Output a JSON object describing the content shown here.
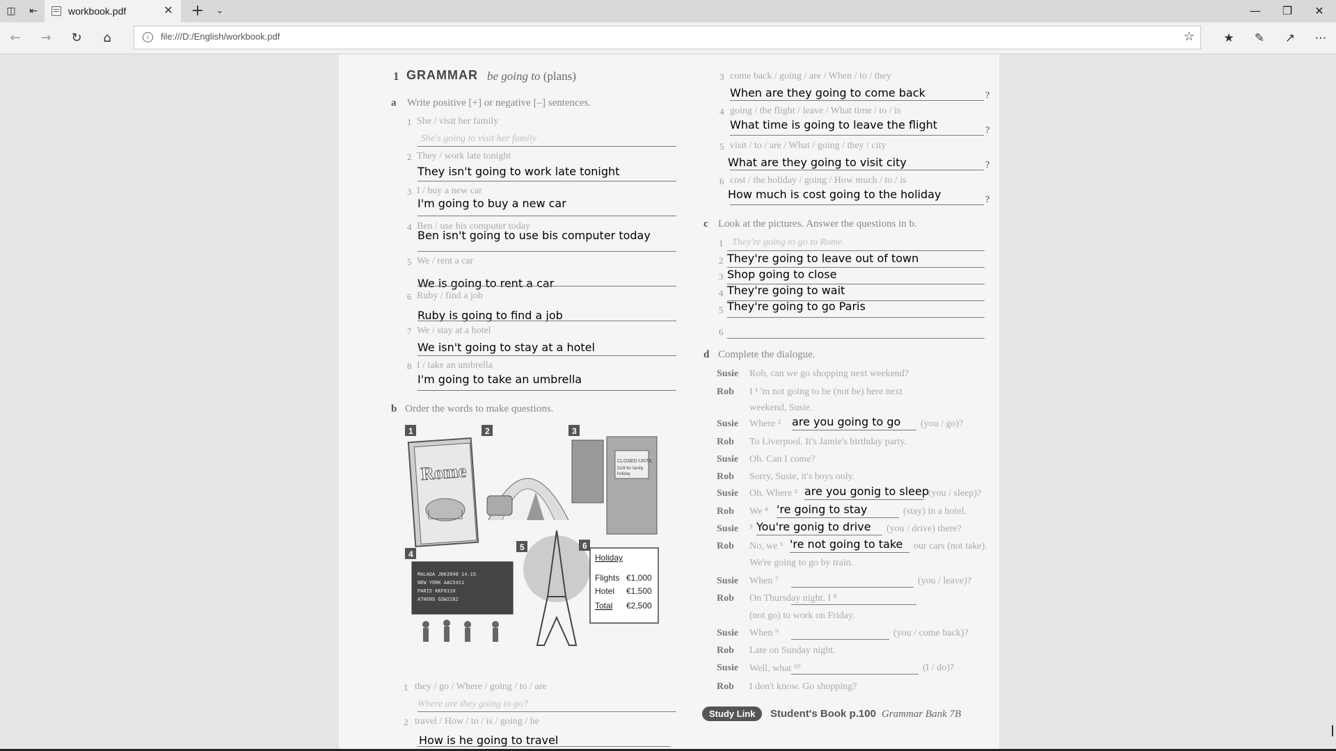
{
  "browser": {
    "tab_title": "workbook.pdf",
    "url": "file:///D:/English/workbook.pdf"
  },
  "heading": {
    "number": "1",
    "title": "GRAMMAR",
    "topic_italic": "be going to",
    "topic_rest": "(plans)"
  },
  "section_a": {
    "letter": "a",
    "instruction": "Write positive [+] or negative [–] sentences.",
    "items": [
      {
        "num": "1",
        "prompt": "She / visit her family",
        "sign": "+",
        "example": "She's going to visit her family",
        "answer": ""
      },
      {
        "num": "2",
        "prompt": "They / work late tonight",
        "sign": "–",
        "answer": "They isn't going to work late tonight"
      },
      {
        "num": "3",
        "prompt": "I / buy a new car",
        "sign": "+",
        "answer": "I'm going to buy a new car"
      },
      {
        "num": "4",
        "prompt": "Ben / use his computer today",
        "sign": "–",
        "answer": "Ben isn't going to use bis computer today"
      },
      {
        "num": "5",
        "prompt": "We / rent a car",
        "sign": "+",
        "answer": "We is going to rent a car"
      },
      {
        "num": "6",
        "prompt": "Ruby / find a job",
        "sign": "+",
        "answer": "Ruby is going to find a job"
      },
      {
        "num": "7",
        "prompt": "We / stay at a hotel",
        "sign": "–",
        "answer": "We isn't going to stay at a hotel"
      },
      {
        "num": "8",
        "prompt": "I / take an umbrella",
        "sign": "–",
        "answer": "I'm going to take an umbrella"
      }
    ]
  },
  "section_b": {
    "letter": "b",
    "instruction": "Order the words to make questions.",
    "pictures": {
      "p1_text": "Rome",
      "p3_sign": "CLOSED UNTIL 31/8 for family holiday",
      "p4_board": [
        "MALAGA   JKK3948  14.15",
        "NEW YORK  AAC5411",
        "PARIS   KKF8110",
        "ATHENS  GSW2282"
      ],
      "p6_title": "Holiday",
      "p6_rows": [
        [
          "Flights",
          "€1,000"
        ],
        [
          "Hotel",
          "€1,500"
        ],
        [
          "Total",
          "€2,500"
        ]
      ]
    },
    "items": [
      {
        "num": "1",
        "prompt": "they / go / Where / going / to / are",
        "example": "Where are they going to go?",
        "answer": ""
      },
      {
        "num": "2",
        "prompt": "travel / How / to / is / going / he",
        "answer": "How is he going to travel"
      },
      {
        "num": "3",
        "prompt": "come back / going / are / When / to / they",
        "answer": "When are they going to come back"
      },
      {
        "num": "4",
        "prompt": "going / the flight / leave / What time / to / is",
        "answer": "What time is going to leave the flight"
      },
      {
        "num": "5",
        "prompt": "visit / to / are / What / going / they / city",
        "answer": "What are they going to visit city"
      },
      {
        "num": "6",
        "prompt": "cost / the holiday / going / How much / to / is",
        "answer": "How much is cost going to the holiday"
      }
    ]
  },
  "section_c": {
    "letter": "c",
    "instruction": "Look at the pictures. Answer the questions in b.",
    "items": [
      {
        "num": "1",
        "example": "They're going to go to Rome.",
        "answer": ""
      },
      {
        "num": "2",
        "answer": "They're going to leave out of town"
      },
      {
        "num": "3",
        "answer": "Shop going to close"
      },
      {
        "num": "4",
        "answer": "They're going to wait"
      },
      {
        "num": "5",
        "answer": "They're going to go Paris"
      },
      {
        "num": "6",
        "answer": ""
      }
    ]
  },
  "section_d": {
    "letter": "d",
    "instruction": "Complete the dialogue.",
    "lines": [
      {
        "speaker": "Susie",
        "text": "Rob, can we go shopping next weekend?"
      },
      {
        "speaker": "Rob",
        "text": "I ¹ 'm not going to be   (not be) here next"
      },
      {
        "speaker": "",
        "text": "weekend, Susie."
      },
      {
        "speaker": "Susie",
        "text": "Where ²",
        "answer": "are you going to go",
        "hint": "(you / go)?"
      },
      {
        "speaker": "Rob",
        "text": "To Liverpool. It's Jamie's birthday party."
      },
      {
        "speaker": "Susie",
        "text": "Oh. Can I come?"
      },
      {
        "speaker": "Rob",
        "text": "Sorry, Susie, it's boys only."
      },
      {
        "speaker": "Susie",
        "text": "Oh. Where ³",
        "answer": "are you gonig to sleep",
        "hint": "(you / sleep)?"
      },
      {
        "speaker": "Rob",
        "text": "We ⁴",
        "answer": "'re going to stay",
        "hint": "(stay) in a hotel."
      },
      {
        "speaker": "Susie",
        "text": "⁵",
        "answer": "You're gonig to drive",
        "hint": "(you / drive) there?"
      },
      {
        "speaker": "Rob",
        "text": "No, we ⁶",
        "answer": "'re not going to take",
        "hint": "our cars (not take)."
      },
      {
        "speaker": "",
        "text": "We're going to go by train."
      },
      {
        "speaker": "Susie",
        "text": "When ⁷",
        "answer": "",
        "hint": "(you / leave)?"
      },
      {
        "speaker": "Rob",
        "text": "On Thursday night. I ⁸",
        "answer": ""
      },
      {
        "speaker": "",
        "text": "(not go) to work on Friday."
      },
      {
        "speaker": "Susie",
        "text": "When ⁹",
        "answer": "",
        "hint": "(you / come back)?"
      },
      {
        "speaker": "Rob",
        "text": "Late on Sunday night."
      },
      {
        "speaker": "Susie",
        "text": "Well, what ¹⁰",
        "answer": "",
        "hint": "(I / do)?"
      },
      {
        "speaker": "Rob",
        "text": "I don't know. Go shopping?"
      }
    ]
  },
  "footer": {
    "study_link": "Study Link",
    "book_ref": "Student's Book p.100",
    "bank_ref": "Grammar Bank 7B"
  }
}
